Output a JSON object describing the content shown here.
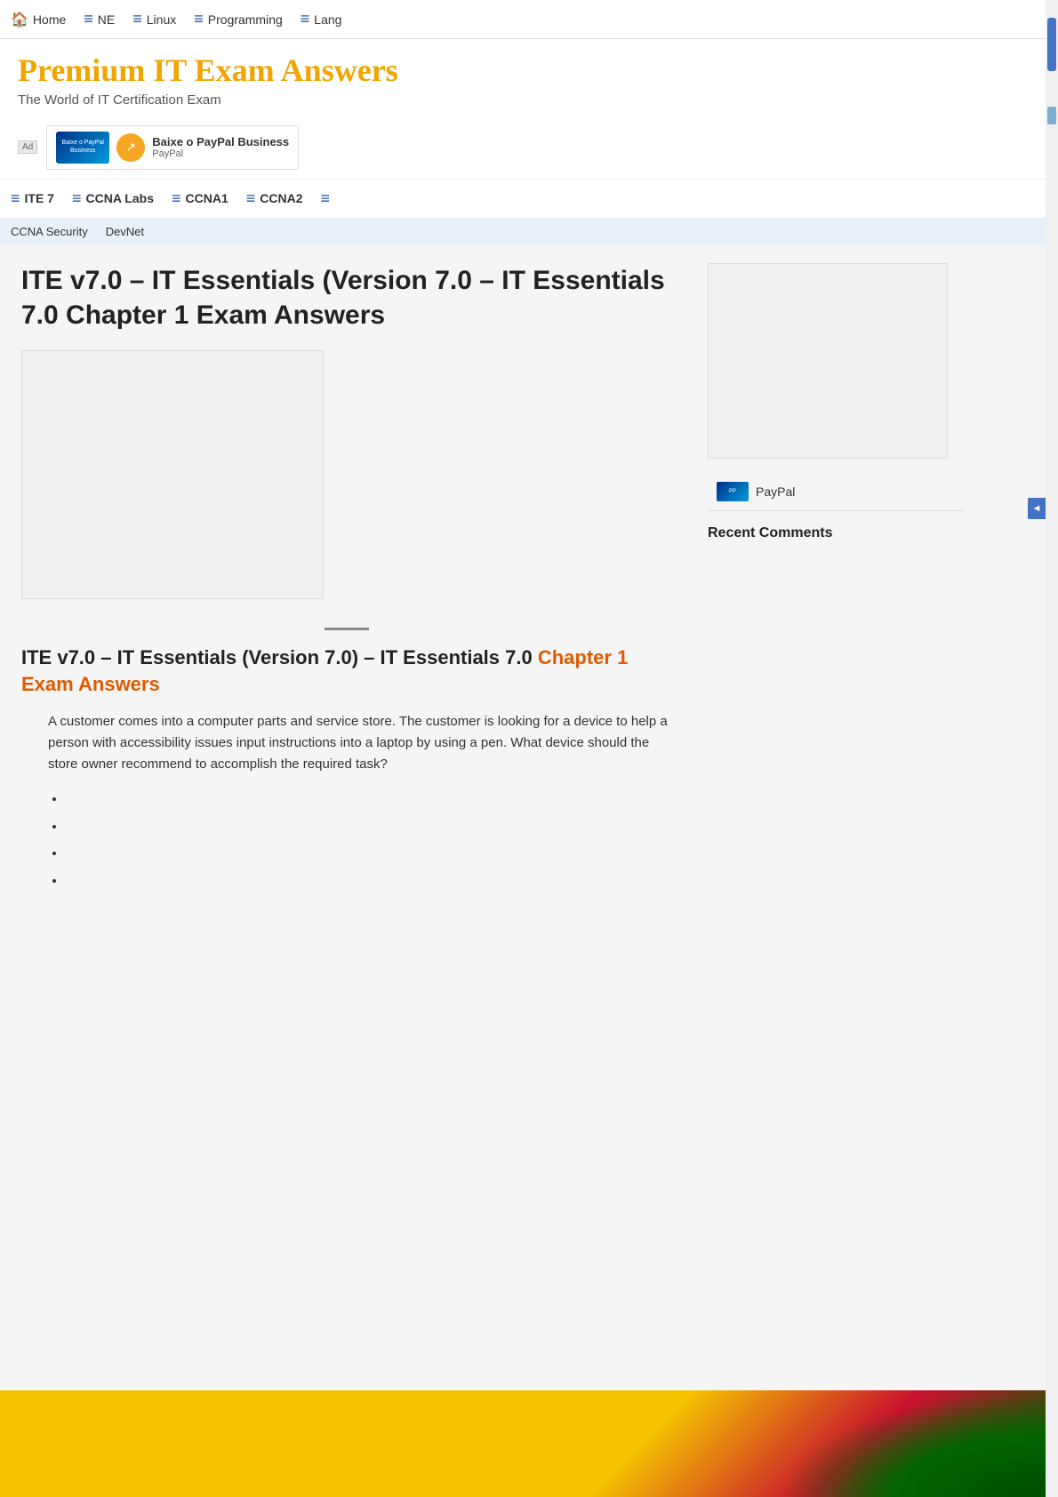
{
  "topNav": {
    "items": [
      {
        "label": "Home",
        "icon": "🏠",
        "type": "home"
      },
      {
        "label": "NE",
        "icon": "≡",
        "type": "menu"
      },
      {
        "label": "Linux",
        "icon": "≡",
        "type": "menu"
      },
      {
        "label": "Programming",
        "icon": "≡",
        "type": "menu"
      },
      {
        "label": "Lang",
        "icon": "≡",
        "type": "menu"
      }
    ]
  },
  "siteHeader": {
    "title": "Premium IT Exam Answers",
    "subtitle": "The World of IT Certification Exam"
  },
  "adBar": {
    "badge": "Ad",
    "adTitle": "Baixe o PayPal Business",
    "adSub": "PayPal",
    "adLogoText": "Baixe o PayPal Business"
  },
  "secondaryNav": {
    "items": [
      {
        "label": "ITE 7",
        "icon": "≡"
      },
      {
        "label": "CCNA Labs",
        "icon": "≡"
      },
      {
        "label": "CCNA1",
        "icon": "≡"
      },
      {
        "label": "CCNA2",
        "icon": "≡"
      },
      {
        "label": "",
        "icon": "≡"
      }
    ]
  },
  "thirdNav": {
    "items": [
      {
        "label": "CCNA Security"
      },
      {
        "label": "DevNet"
      }
    ]
  },
  "pageTitle": "ITE v7.0 – IT Essentials (Version 7.0 – IT Essentials 7.0 Chapter 1 Exam Answers",
  "articleHeading": "ITE v7.0 – IT Essentials (Version 7.0) – IT Essentials 7.0",
  "articleHighlight": "Chapter 1 Exam Answers",
  "questionText": "A customer comes into a computer parts and service store. The customer is looking for a device to help a person with accessibility issues input instructions into a laptop by using a pen. What device should the store owner recommend to accomplish the required task?",
  "answers": [
    "",
    "",
    "",
    ""
  ],
  "sidebar": {
    "paypalLabel": "PayPal",
    "recentCommentsTitle": "Recent Comments"
  },
  "feedbackTab": "◄"
}
